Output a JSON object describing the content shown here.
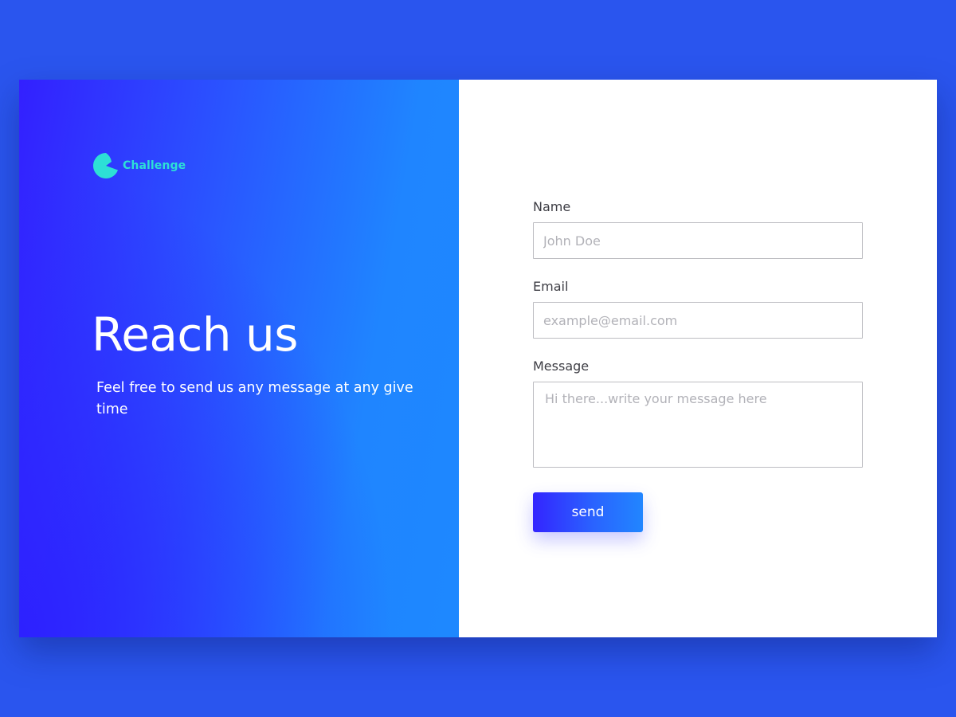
{
  "brand": {
    "name": "Challenge",
    "logo_icon": "pie-circle-logo-icon",
    "logo_color": "#2de0d6"
  },
  "hero": {
    "headline": "Reach us",
    "subheadline": "Feel free to send us any message at any give time"
  },
  "form": {
    "name": {
      "label": "Name",
      "value": "",
      "placeholder": "John Doe"
    },
    "email": {
      "label": "Email",
      "value": "",
      "placeholder": "example@email.com"
    },
    "message": {
      "label": "Message",
      "value": "",
      "placeholder": "Hi there...write your message here"
    },
    "submit_label": "send"
  },
  "colors": {
    "page_background": "#2a55ee",
    "panel_gradient_start": "#3320ff",
    "panel_gradient_end": "#1e88ff",
    "form_background": "#ffffff",
    "button_gradient_start": "#3325ff",
    "button_gradient_end": "#2186ff"
  }
}
